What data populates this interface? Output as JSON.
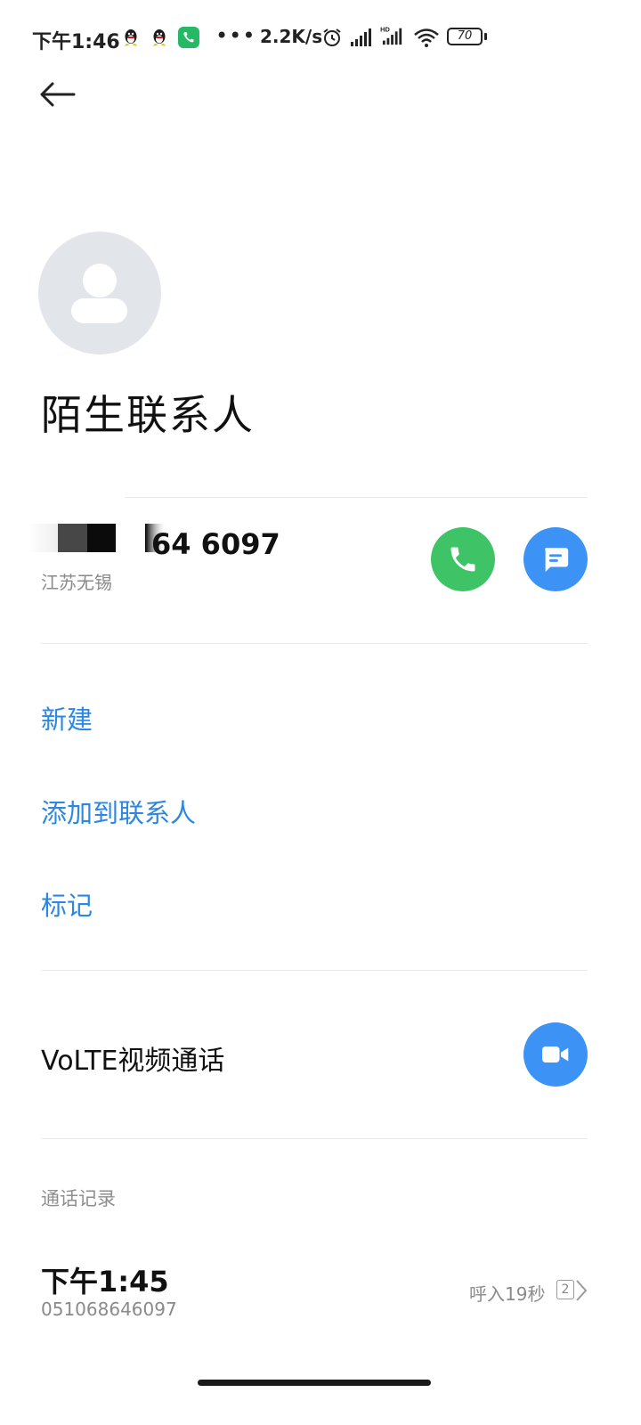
{
  "status_bar": {
    "time": "下午1:46",
    "net_speed": "2.2K/s",
    "battery": "70",
    "icons": [
      "qq-icon",
      "qq-icon",
      "phone-app-icon",
      "more-dots-icon",
      "alarm-icon",
      "signal-icon",
      "hd-signal-icon",
      "wifi-icon",
      "battery-icon"
    ]
  },
  "header": {
    "back_icon": "back-arrow-icon"
  },
  "contact": {
    "name": "陌生联系人",
    "number_visible": "64 6097",
    "location": "江苏无锡"
  },
  "actions": {
    "new": "新建",
    "add_to_contacts": "添加到联系人",
    "mark": "标记"
  },
  "volte": {
    "label": "VoLTE视频通话"
  },
  "call_log": {
    "title": "通话记录",
    "entries": [
      {
        "time": "下午1:45",
        "number": "051068646097",
        "detail": "呼入19秒",
        "count": "2"
      }
    ]
  },
  "colors": {
    "accent": "#2c87e3",
    "call_green": "#3ec467",
    "action_blue": "#3d93f5",
    "avatar_bg": "#e2e5e9"
  }
}
